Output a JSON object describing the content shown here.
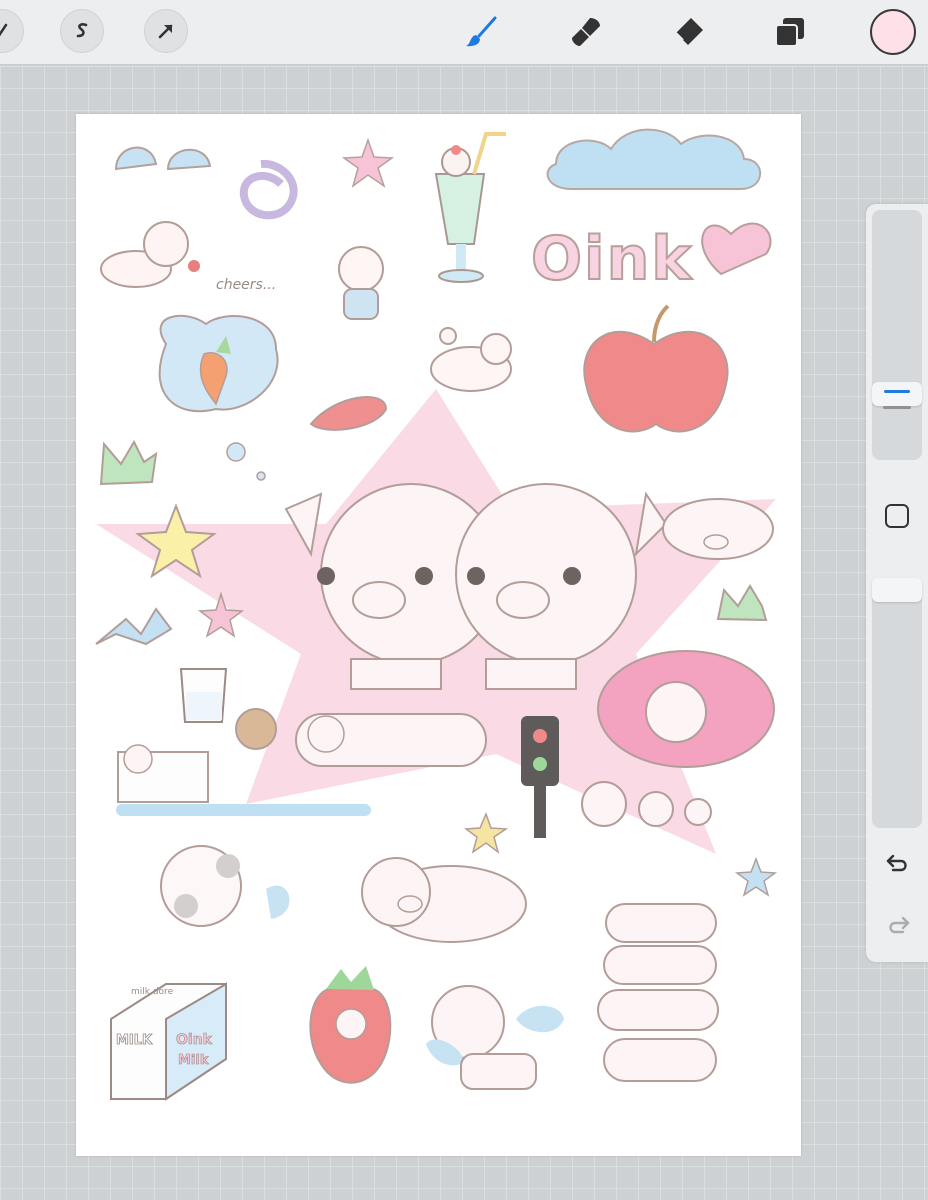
{
  "toolbar": {
    "left_buttons": [
      "adjustments-icon",
      "selection-icon",
      "transform-arrow-icon"
    ],
    "tools": [
      "brush-icon",
      "smudge-icon",
      "eraser-icon",
      "layers-icon"
    ],
    "active_tool": "brush-icon",
    "accent_color": "#1f7ae0",
    "current_color": "#fde0e8"
  },
  "sidebar": {
    "size_slider_value": 0.47,
    "opacity_slider_value": 0.0,
    "modify_button": "square-modify-icon",
    "undo": "undo-icon",
    "redo": "redo-icon"
  },
  "canvas": {
    "texts": {
      "cheers": "cheers...",
      "oink_big": "Oink",
      "milk_carton_top": "milk dore",
      "milk_label": "MILK",
      "oink_milk_1": "Oink",
      "oink_milk_2": "Milk"
    },
    "colors": {
      "pink_star": "#f7c6d6",
      "apple": "#f08a8a",
      "cloud": "#bfe0f2",
      "donut": "#f29ab8",
      "outline": "#a58d88"
    }
  }
}
